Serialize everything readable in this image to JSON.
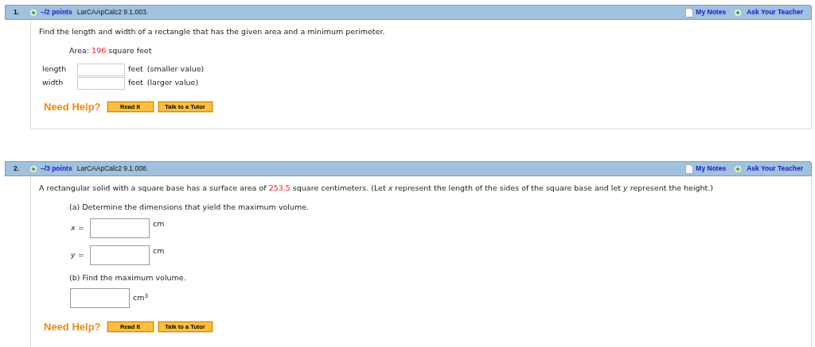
{
  "questions": [
    {
      "number": "1.",
      "points": "–/2 points",
      "code": "LarCAApCalc2 9.1.003.",
      "notes": "My Notes",
      "ask": "Ask Your Teacher",
      "body": [
        {
          "kind": "prompt",
          "before": "Find the length and width of a rectangle that has the given area and a minimum perimeter."
        },
        {
          "kind": "given",
          "before": "Area:",
          "value": "196",
          "after": "square feet"
        },
        {
          "kind": "labeled_fields",
          "rows": [
            {
              "label": "length",
              "unit": "feet",
              "note": "(smaller value)"
            },
            {
              "label": "width",
              "unit": "feet",
              "note": "(larger value)"
            }
          ]
        }
      ],
      "help": "Need Help?",
      "buttons": [
        "Read It",
        "Talk to a Tutor"
      ]
    },
    {
      "number": "2.",
      "points": "–/3 points",
      "code": "LarCAApCalc2 9.1.008.",
      "notes": "My Notes",
      "ask": "Ask Your Teacher",
      "body": [
        {
          "kind": "prompt",
          "before": "A rectangular solid with a square base has a surface area of",
          "value": "253.5",
          "after": "square centimeters. (Let *x* represent the length of the sides of the square base and let *y* represent the height.)"
        },
        {
          "kind": "part",
          "text": "(a) Determine the dimensions that yield the maximum volume."
        },
        {
          "kind": "var_field",
          "var": "x",
          "eq": "=",
          "unit": "cm"
        },
        {
          "kind": "var_field",
          "var": "y",
          "eq": "=",
          "unit": "cm"
        },
        {
          "kind": "part",
          "text": "(b) Find the maximum volume."
        },
        {
          "kind": "answer_field",
          "unit": "cm$^{3}$"
        }
      ],
      "help": "Need Help?",
      "buttons": [
        "Read It",
        "Talk to a Tutor"
      ]
    }
  ]
}
